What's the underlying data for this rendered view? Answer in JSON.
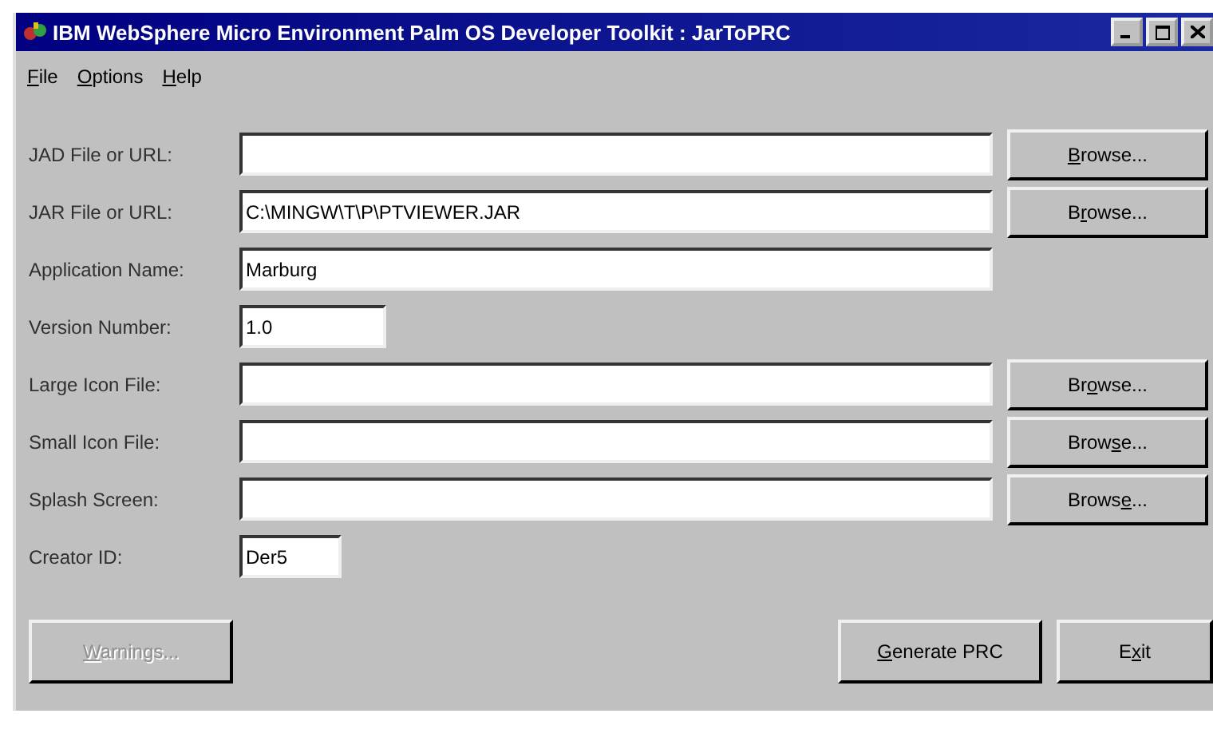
{
  "window": {
    "title": "IBM WebSphere Micro Environment Palm OS Developer Toolkit : JarToPRC"
  },
  "menu": [
    {
      "key": "F",
      "post": "ile"
    },
    {
      "key": "O",
      "post": "ptions"
    },
    {
      "key": "H",
      "post": "elp"
    }
  ],
  "fields": [
    {
      "label": "JAD File or URL:",
      "kind": "wide",
      "browse": {
        "key": "B",
        "post": "rowse..."
      }
    },
    {
      "label": "JAR File or URL:",
      "kind": "wide",
      "value": "C:\\MINGW\\T\\P\\PTVIEWER.JAR",
      "browse": {
        "pre": "B",
        "key": "r",
        "post": "owse..."
      }
    },
    {
      "label": "Application Name:",
      "kind": "wide",
      "value": "Marburg"
    },
    {
      "label": "Version Number:",
      "kind": "short",
      "value": "1.0"
    },
    {
      "label": "Large Icon File:",
      "kind": "wide",
      "browse": {
        "pre": "Br",
        "key": "o",
        "post": "wse..."
      }
    },
    {
      "label": "Small Icon File:",
      "kind": "wide",
      "browse": {
        "pre": "Brow",
        "key": "s",
        "post": "e..."
      }
    },
    {
      "label": "Splash Screen:",
      "kind": "wide",
      "browse": {
        "pre": "Brows",
        "key": "e",
        "post": "..."
      }
    },
    {
      "label": "Creator ID:",
      "kind": "tiny",
      "value": "Der5"
    }
  ],
  "buttons": [
    {
      "key": "W",
      "post": "arnings...",
      "disabled": true,
      "kind": "left"
    },
    {
      "key": "G",
      "post": "enerate PRC",
      "disabled": false,
      "kind": "right"
    },
    {
      "pre": "E",
      "key": "x",
      "post": "it",
      "disabled": false,
      "kind": "right"
    }
  ]
}
